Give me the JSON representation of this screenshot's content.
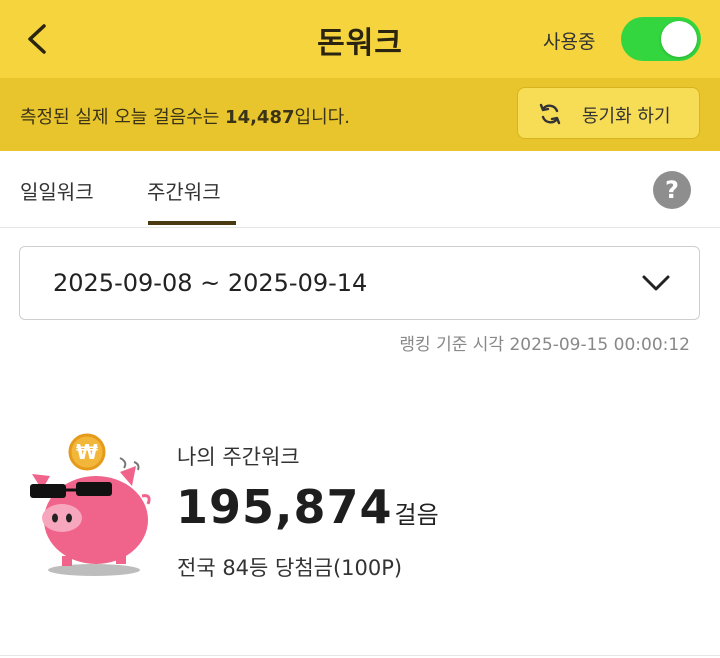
{
  "header": {
    "title": "돈워크",
    "status_label": "사용중",
    "toggle_on": true,
    "accent_color": "#f5d43d",
    "toggle_color": "#33d63f"
  },
  "notice": {
    "text_before": "측정된 실제 오늘 걸음수는 ",
    "steps": "14,487",
    "text_after": "입니다.",
    "sync_label": "동기화 하기",
    "sync_icon": "refresh-icon"
  },
  "tabs": [
    {
      "label": "일일워크",
      "active": false
    },
    {
      "label": "주간워크",
      "active": true
    }
  ],
  "help_icon_glyph": "?",
  "date_range": {
    "selected": "2025-09-08 ~ 2025-09-14"
  },
  "ranking_time": "랭킹 기준 시각 2025-09-15 00:00:12",
  "my_walk": {
    "label": "나의 주간워크",
    "steps": "195,874",
    "unit": "걸음",
    "rank": "전국 84등 당첨금(100P)",
    "mascot_coin_symbol": "₩"
  }
}
